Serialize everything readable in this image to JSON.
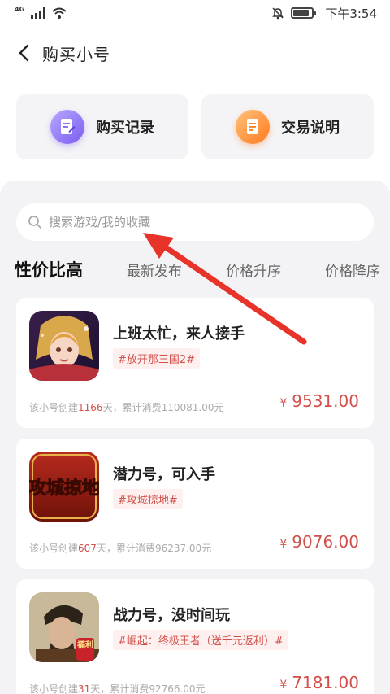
{
  "status_bar": {
    "network": "4G",
    "time": "下午3:54"
  },
  "header": {
    "title": "购买小号"
  },
  "actions": [
    {
      "label": "购买记录",
      "icon": "document-edit-icon",
      "color": "#7a5cf0"
    },
    {
      "label": "交易说明",
      "icon": "document-list-icon",
      "color": "#ff7a1f"
    }
  ],
  "search": {
    "placeholder": "搜索游戏/我的收藏"
  },
  "tabs": [
    {
      "label": "性价比高",
      "active": true
    },
    {
      "label": "最新发布",
      "active": false
    },
    {
      "label": "价格升序",
      "active": false
    },
    {
      "label": "价格降序",
      "active": false
    }
  ],
  "listings": [
    {
      "title": "上班太忙，来人接手",
      "tag": "#放开那三国2#",
      "meta_prefix": "该小号创建",
      "days": "1166",
      "meta_mid": "天，累计消费",
      "spent": "110081.00",
      "meta_suffix": "元",
      "currency": "¥",
      "price": "9531.00"
    },
    {
      "title": "潜力号，可入手",
      "tag": "#攻城掠地#",
      "meta_prefix": "该小号创建",
      "days": "607",
      "meta_mid": "天，累计消费",
      "spent": "96237.00",
      "meta_suffix": "元",
      "currency": "¥",
      "price": "9076.00"
    },
    {
      "title": "战力号，没时间玩",
      "tag": "#崛起：终极王者（送千元返利）#",
      "meta_prefix": "该小号创建",
      "days": "31",
      "meta_mid": "天，累计消费",
      "spent": "92766.00",
      "meta_suffix": "元",
      "currency": "¥",
      "price": "7181.00"
    }
  ],
  "thumb_text": {
    "game2_logo": "攻城掠地",
    "game3_badge": "福利"
  },
  "colors": {
    "accent_red": "#d2504a",
    "panel_bg": "#f3f3f5",
    "annotation_arrow": "#e8332a"
  }
}
